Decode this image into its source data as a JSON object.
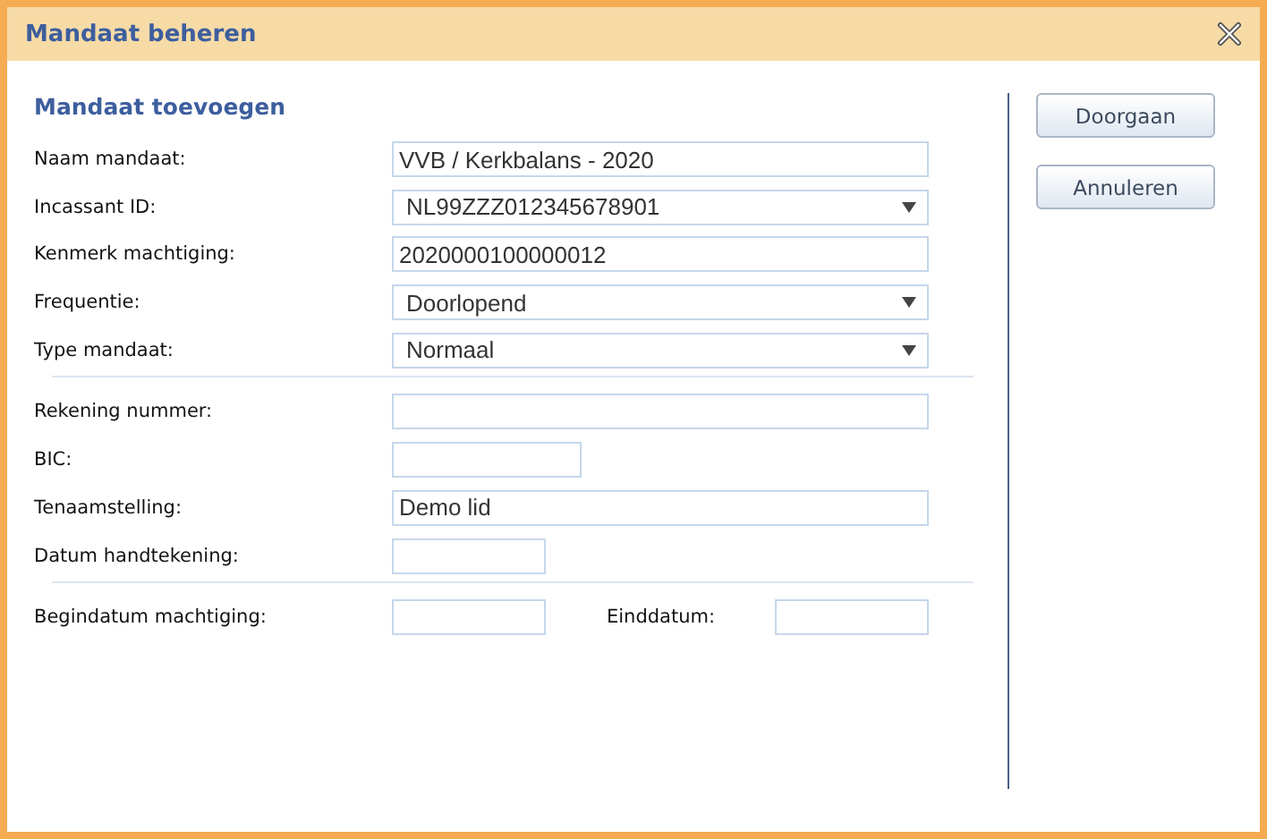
{
  "window": {
    "title": "Mandaat beheren"
  },
  "form": {
    "heading": "Mandaat toevoegen",
    "sections": [
      {
        "rows": [
          [
            {
              "label": "Naam mandaat:",
              "kind": "text",
              "value": "VVB / Kerkbalans - 2020"
            }
          ],
          [
            {
              "label": "Incassant ID:",
              "kind": "select",
              "value": "NL99ZZZ012345678901"
            }
          ],
          [
            {
              "label": "Kenmerk machtiging:",
              "kind": "text",
              "value": "2020000100000012"
            }
          ],
          [
            {
              "label": "Frequentie:",
              "kind": "select",
              "value": "Doorlopend"
            }
          ],
          [
            {
              "label": "Type mandaat:",
              "kind": "select",
              "value": "Normaal"
            }
          ]
        ]
      },
      {
        "rows": [
          [
            {
              "label": "Rekening nummer:",
              "kind": "text"
            }
          ],
          [
            {
              "label": "BIC:",
              "kind": "code"
            }
          ],
          [
            {
              "label": "Tenaamstelling:",
              "kind": "text",
              "value": "Demo lid"
            }
          ],
          [
            {
              "label": "Datum handtekening:",
              "kind": "date"
            }
          ]
        ]
      },
      {
        "rows": [
          [
            {
              "label": "Begindatum machtiging:",
              "kind": "date"
            },
            {
              "label": "Einddatum:",
              "kind": "date"
            }
          ]
        ]
      }
    ]
  },
  "buttons": [
    "Doorgaan",
    "Annuleren"
  ]
}
